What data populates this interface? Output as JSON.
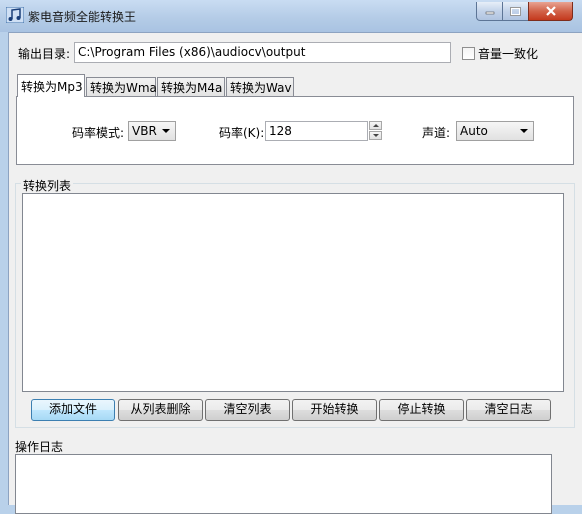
{
  "window": {
    "title": "紫电音频全能转换王"
  },
  "output": {
    "label": "输出目录:",
    "path": "C:\\Program Files (x86)\\audiocv\\output",
    "normalize_label": "音量一致化",
    "normalize_checked": false
  },
  "tabs": [
    {
      "label": "转换为Mp3",
      "active": true
    },
    {
      "label": "转换为Wma",
      "active": false
    },
    {
      "label": "转换为M4a",
      "active": false
    },
    {
      "label": "转换为Wav",
      "active": false
    }
  ],
  "settings": {
    "bitrate_mode_label": "码率模式:",
    "bitrate_mode_value": "VBR",
    "bitrate_label": "码率(K):",
    "bitrate_value": "128",
    "channel_label": "声道:",
    "channel_value": "Auto"
  },
  "convert_list": {
    "label": "转换列表"
  },
  "buttons": {
    "add_file": "添加文件",
    "remove_from_list": "从列表删除",
    "clear_list": "清空列表",
    "start": "开始转换",
    "stop": "停止转换",
    "clear_log": "清空日志"
  },
  "log": {
    "label": "操作日志"
  }
}
